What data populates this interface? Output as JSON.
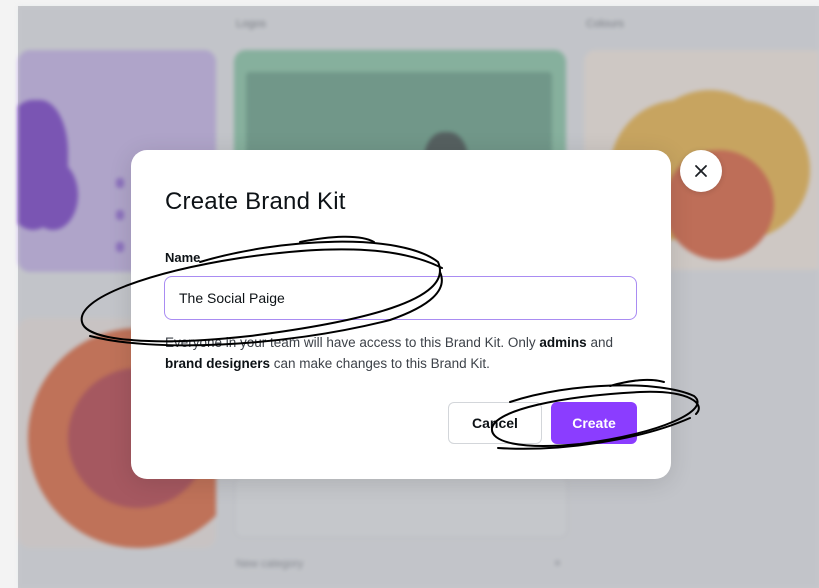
{
  "background": {
    "section_labels": [
      "Logos",
      "Colours"
    ],
    "new_category_label": "New category",
    "new_category_remove": "×"
  },
  "dialog": {
    "title": "Create Brand Kit",
    "name_label": "Name",
    "name_value": "The Social Paige",
    "help_text": {
      "part1": "Everyone in your team will have access to this Brand Kit. Only ",
      "admins": "admins",
      "part2": " and ",
      "brand_designers": "brand designers",
      "part3": " can make changes to this Brand Kit."
    },
    "cancel_label": "Cancel",
    "create_label": "Create",
    "close_icon": "close-icon"
  },
  "colors": {
    "accent": "#8b3dff",
    "input_border": "#a98cf2",
    "annotation_ink": "#000000"
  }
}
